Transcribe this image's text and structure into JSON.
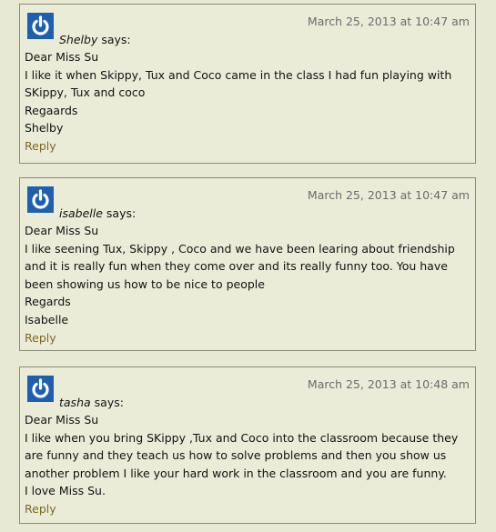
{
  "comments": [
    {
      "date": "March 25, 2013 at 10:47 am",
      "author": "Shelby",
      "says": "says:",
      "lines": [
        "Dear Miss Su",
        "I like it when Skippy, Tux and Coco came in the class I had fun playing with SKippy, Tux and coco",
        "Regaards",
        "Shelby"
      ],
      "reply": "Reply"
    },
    {
      "date": "March 25, 2013 at 10:47 am",
      "author": "isabelle",
      "says": "says:",
      "lines": [
        "Dear Miss Su",
        "I like seening Tux, Skippy , Coco and we have been learing about friendship and it is really fun when they come over and its really funny too. You have been showing us how to be nice to people",
        "Regards",
        "Isabelle"
      ],
      "reply": "Reply"
    },
    {
      "date": "March 25, 2013 at 10:48 am",
      "author": "tasha",
      "says": "says:",
      "lines": [
        "Dear Miss Su",
        "I like when you bring SKippy ,Tux and Coco into the classroom because they are funny and they teach us how to solve problems and then you show us another problem I like your hard work in the classroom and you are funny.",
        "I love Miss Su."
      ],
      "reply": "Reply"
    }
  ],
  "avatar_icon": "power-icon",
  "colors": {
    "avatar": "#1f5fb0",
    "reply": "#7b6a22",
    "date": "#6a6b6b"
  }
}
